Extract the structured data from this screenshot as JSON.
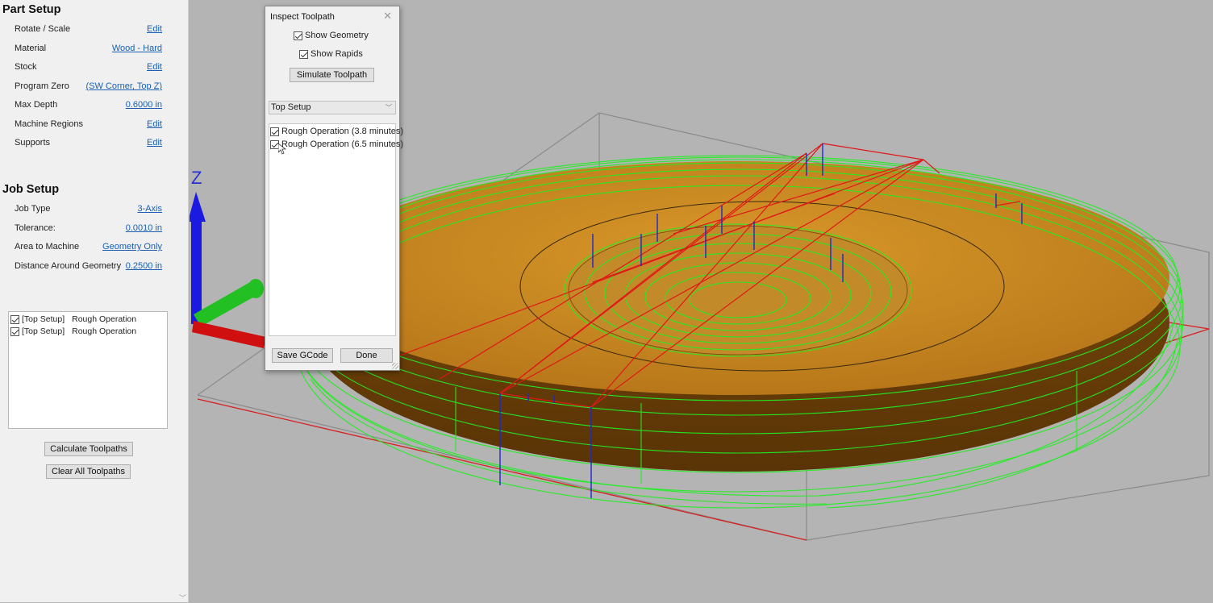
{
  "part_setup": {
    "title": "Part Setup",
    "rows": [
      {
        "label": "Rotate / Scale",
        "value": "Edit"
      },
      {
        "label": "Material",
        "value": "Wood - Hard"
      },
      {
        "label": "Stock",
        "value": "Edit"
      },
      {
        "label": "Program Zero",
        "value": "(SW Corner, Top Z)"
      },
      {
        "label": "Max Depth",
        "value": "0.6000 in"
      },
      {
        "label": "Machine Regions",
        "value": "Edit"
      },
      {
        "label": "Supports",
        "value": "Edit"
      }
    ]
  },
  "job_setup": {
    "title": "Job Setup",
    "rows": [
      {
        "label": "Job Type",
        "value": "3-Axis"
      },
      {
        "label": "Tolerance:",
        "value": "0.0010 in"
      },
      {
        "label": "Area to Machine",
        "value": "Geometry Only"
      },
      {
        "label": "Distance Around Geometry",
        "value": "0.2500 in"
      }
    ]
  },
  "operations": [
    {
      "setup": "[Top Setup]",
      "name": "Rough Operation",
      "checked": true
    },
    {
      "setup": "[Top Setup]",
      "name": "Rough Operation",
      "checked": true
    }
  ],
  "buttons": {
    "calculate": "Calculate Toolpaths",
    "clear_all": "Clear All Toolpaths"
  },
  "viewport": {
    "axis_label_z": "Z",
    "colors": {
      "background": "#b4b4b4",
      "part": "#c98a1e",
      "toolpath": "#22ee22",
      "rapids": "#e01818",
      "plunge": "#1a2acc",
      "stock_box": "#888888"
    }
  },
  "dialog": {
    "title": "Inspect Toolpath",
    "close_glyph": "✕",
    "show_geometry": "Show Geometry",
    "show_rapids": "Show Rapids",
    "simulate": "Simulate Toolpath",
    "setup_selected": "Top Setup",
    "operations": [
      {
        "label": "Rough Operation (3.8 minutes)",
        "checked": true
      },
      {
        "label": "Rough Operation (6.5 minutes)",
        "checked": true
      }
    ],
    "save_gcode": "Save GCode",
    "done": "Done"
  }
}
